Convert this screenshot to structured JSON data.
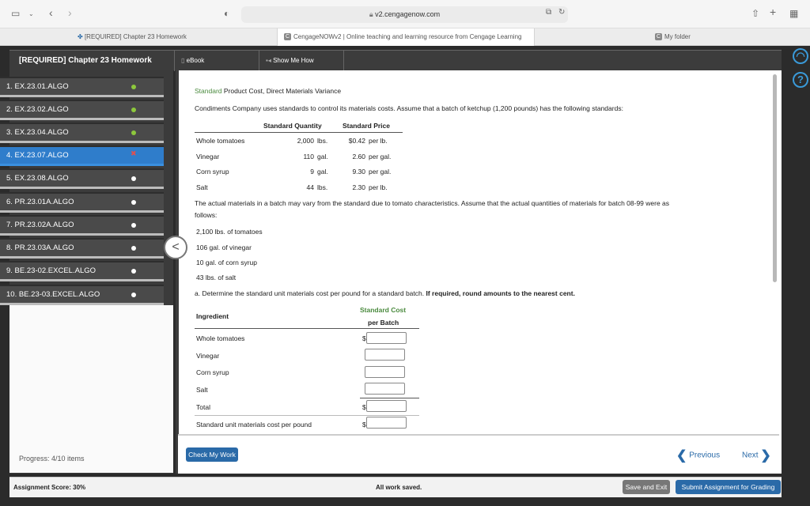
{
  "browser": {
    "url": "v2.cengagenow.com",
    "tabs": [
      {
        "label": "[REQUIRED] Chapter 23 Homework"
      },
      {
        "label": "CengageNOWv2 | Online teaching and learning resource from Cengage Learning"
      },
      {
        "label": "My folder"
      }
    ]
  },
  "header": {
    "title": "[REQUIRED] Chapter 23 Homework",
    "ebook": "eBook",
    "show_me_how": "Show Me How"
  },
  "sidebar": {
    "items": [
      {
        "label": "1. EX.23.01.ALGO",
        "status": "complete"
      },
      {
        "label": "2. EX.23.02.ALGO",
        "status": "complete"
      },
      {
        "label": "3. EX.23.04.ALGO",
        "status": "complete"
      },
      {
        "label": "4. EX.23.07.ALGO",
        "status": "incorrect"
      },
      {
        "label": "5. EX.23.08.ALGO",
        "status": "none"
      },
      {
        "label": "6. PR.23.01A.ALGO",
        "status": "none"
      },
      {
        "label": "7. PR.23.02A.ALGO",
        "status": "none"
      },
      {
        "label": "8. PR.23.03A.ALGO",
        "status": "none"
      },
      {
        "label": "9. BE.23-02.EXCEL.ALGO",
        "status": "none"
      },
      {
        "label": "10. BE.23-03.EXCEL.ALGO",
        "status": "none"
      }
    ],
    "progress": "Progress: 4/10 items"
  },
  "problem": {
    "title_green": "Standard",
    "title_rest": "Product Cost, Direct Materials Variance",
    "intro": "Condiments Company uses standards to control its materials costs. Assume that a batch of ketchup (1,200 pounds) has the following standards:",
    "std_headers": [
      "Standard Quantity",
      "Standard Price"
    ],
    "std_rows": [
      {
        "name": "Whole tomatoes",
        "qty": "2,000",
        "qunit": "lbs.",
        "price": "$0.42",
        "punit": "per lb."
      },
      {
        "name": "Vinegar",
        "qty": "110",
        "qunit": "gal.",
        "price": "2.60",
        "punit": "per gal."
      },
      {
        "name": "Corn syrup",
        "qty": "9",
        "qunit": "gal.",
        "price": "9.30",
        "punit": "per gal."
      },
      {
        "name": "Salt",
        "qty": "44",
        "qunit": "lbs.",
        "price": "2.30",
        "punit": "per lb."
      }
    ],
    "actual_intro_1": "The actual materials in a batch may vary from the standard due to tomato characteristics. Assume that the actual quantities of materials for batch 08-99 were as",
    "actual_intro_2": "follows:",
    "actuals": [
      "2,100 lbs. of tomatoes",
      "106 gal. of vinegar",
      "10 gal. of corn syrup",
      "43 lbs. of salt"
    ],
    "part_a_normal": "a.  Determine the standard unit materials cost per pound for a standard batch. ",
    "part_a_bold": "If required, round amounts to the nearest cent.",
    "answer_header_ingredient": "Ingredient",
    "answer_header_cost_1": "Standard Cost",
    "answer_header_cost_2": "per Batch",
    "answer_rows": [
      "Whole tomatoes",
      "Vinegar",
      "Corn syrup",
      "Salt",
      "Total",
      "Standard unit materials cost per pound"
    ],
    "dollar": "$"
  },
  "bottom": {
    "check": "Check My Work",
    "previous": "Previous",
    "next": "Next"
  },
  "footer": {
    "score": "Assignment Score:",
    "score_value": "30%",
    "saved": "All work saved.",
    "save_exit": "Save and Exit",
    "submit": "Submit Assignment for Grading"
  }
}
